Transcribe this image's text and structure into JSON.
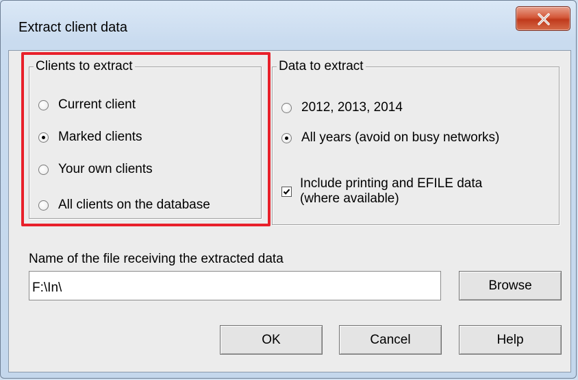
{
  "window": {
    "title": "Extract client data"
  },
  "clients_group": {
    "legend": "Clients to extract",
    "options": [
      {
        "label": "Current client",
        "checked": false
      },
      {
        "label": "Marked clients",
        "checked": true
      },
      {
        "label": "Your own clients",
        "checked": false
      },
      {
        "label": "All clients on the database",
        "checked": false
      }
    ],
    "highlight_color": "#e8202a"
  },
  "data_group": {
    "legend": "Data to extract",
    "options": [
      {
        "label": "2012, 2013, 2014",
        "checked": false
      },
      {
        "label": "All years (avoid on busy networks)",
        "checked": true
      }
    ],
    "include_checkbox": {
      "line1": "Include printing and EFILE data",
      "line2": "(where available)",
      "checked": true
    }
  },
  "file": {
    "label": "Name of the file receiving the extracted data",
    "value": "F:\\In\\",
    "browse_label": "Browse"
  },
  "buttons": {
    "ok": "OK",
    "cancel": "Cancel",
    "help": "Help"
  },
  "icons": {
    "close": "close-icon",
    "check": "checkmark-icon"
  }
}
